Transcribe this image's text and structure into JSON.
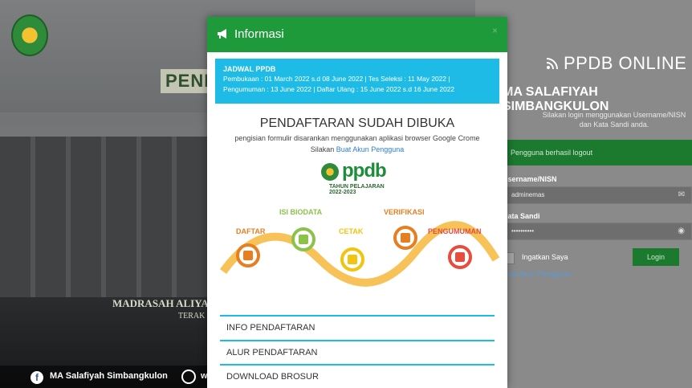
{
  "background": {
    "banner_sign": "PENI",
    "madrasah_sign": "MADRASAH ALIYAH",
    "madrasah_sign2": "TERAK",
    "facebook_label": "MA Salafiyah Simbangkulon",
    "web_label": "w"
  },
  "login_panel": {
    "title": "PPDB ONLINE",
    "school_name": "MA SALAFIYAH SIMBANGKULON",
    "hint": "Silakan login menggunakan Username/NISN dan Kata Sandi anda.",
    "logout_message": "Pengguna berhasil logout",
    "username_label": "Username/NISN",
    "username_value": "adminemas",
    "password_label": "Kata Sandi",
    "password_value": "••••••••••",
    "remember_label": "Ingatkan Saya",
    "login_button": "Login",
    "create_account": "Buat Akun Pengguna"
  },
  "modal": {
    "header": "Informasi",
    "close": "×",
    "schedule_title": "JADWAL PPDB",
    "schedule_line1": "Pembukaan : 01 March 2022 s.d 08 June 2022 | Tes Seleksi : 11 May 2022 |",
    "schedule_line2": "Pengumuman : 13 June 2022 | Daftar Ulang : 15 June 2022 s.d 16 June 2022",
    "open_title": "PENDAFTARAN SUDAH DIBUKA",
    "recommend_text": "pengisian formulir disarankan menggunakan aplikasi browser Google Crome",
    "create_prefix": "Silakan",
    "create_link": "Buat Akun Pengguna",
    "logo_text": "ppdb",
    "logo_year": "TAHUN PELAJARAN 2022-2023",
    "flow_steps": [
      {
        "label": "DAFTAR",
        "color": "#e67e22"
      },
      {
        "label": "ISI BIODATA",
        "color": "#8bc34a"
      },
      {
        "label": "CETAK",
        "color": "#f1c40f"
      },
      {
        "label": "VERIFIKASI",
        "color": "#e67e22"
      },
      {
        "label": "PENGUMUMAN",
        "color": "#e74c3c"
      }
    ],
    "menu": [
      "INFO PENDAFTARAN",
      "ALUR PENDAFTARAN",
      "DOWNLOAD BROSUR"
    ]
  }
}
